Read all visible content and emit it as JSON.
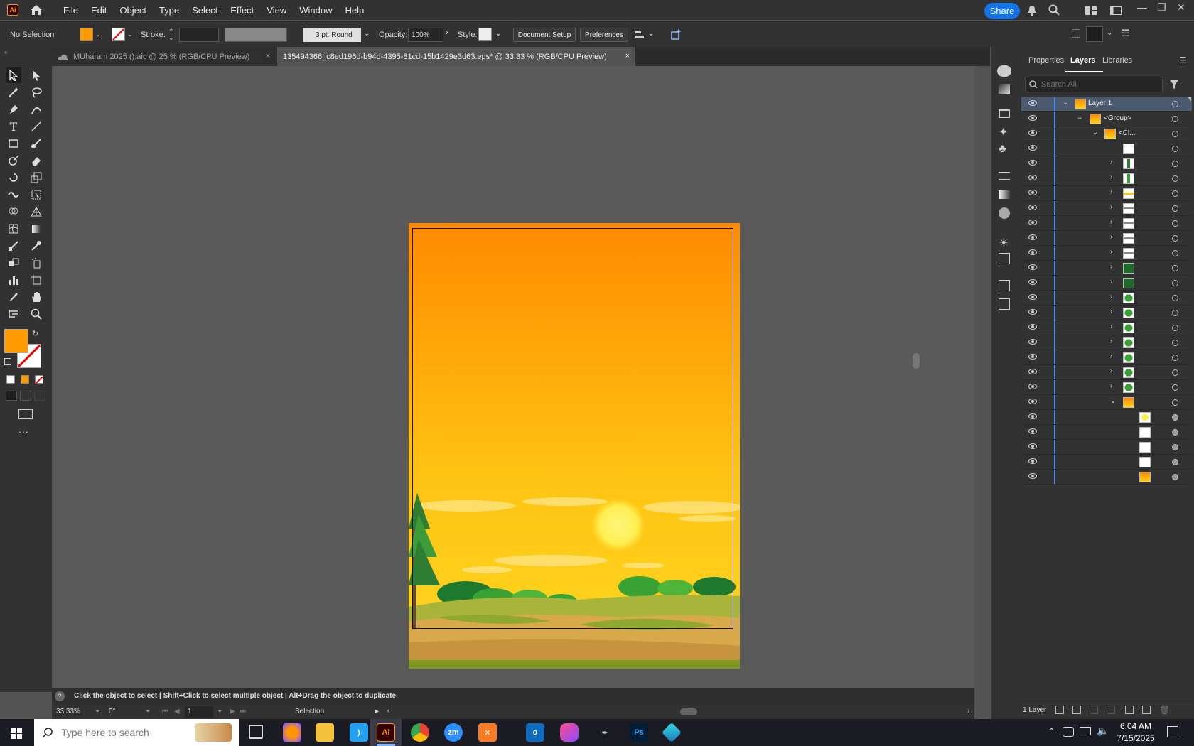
{
  "menubar": {
    "logo": "Ai",
    "items": [
      "File",
      "Edit",
      "Object",
      "Type",
      "Select",
      "Effect",
      "View",
      "Window",
      "Help"
    ],
    "share_label": "Share"
  },
  "control_bar": {
    "selection": "No Selection",
    "stroke_label": "Stroke:",
    "brush_label": "3 pt. Round",
    "opacity_label": "Opacity:",
    "opacity_value": "100%",
    "style_label": "Style:",
    "document_setup": "Document Setup",
    "preferences": "Preferences"
  },
  "tabs": [
    {
      "label": "MUharam 2025 ().aic @ 25 % (RGB/CPU Preview)",
      "close": "×"
    },
    {
      "label": "135494366_c8ed196d-b94d-4395-81cd-15b1429e3d63.eps* @ 33.33 % (RGB/CPU Preview)",
      "close": "×"
    }
  ],
  "status_bar": {
    "hint": "Click the object to select  |  Shift+Click to select multiple object  |  Alt+Drag the object to duplicate",
    "zoom": "33.33%",
    "rotation": "0°",
    "artboard": "1",
    "tool": "Selection"
  },
  "panels": {
    "tabs": [
      "Properties",
      "Layers",
      "Libraries"
    ],
    "search_placeholder": "Search All",
    "layer_name": "Layer 1",
    "group_name": "<Group>",
    "clip_name": "<Cl...",
    "footer_count": "1 Layer"
  },
  "colors": {
    "fill": "#ff9a00",
    "accent": "#1473e6",
    "sky_top": "#ff8a00",
    "sky_bottom": "#ffd21a"
  },
  "taskbar": {
    "search_placeholder": "Type here to search",
    "time": "6:04 AM",
    "date": "7/15/2025",
    "apps": [
      "Ai",
      "Ps",
      "zm"
    ]
  }
}
